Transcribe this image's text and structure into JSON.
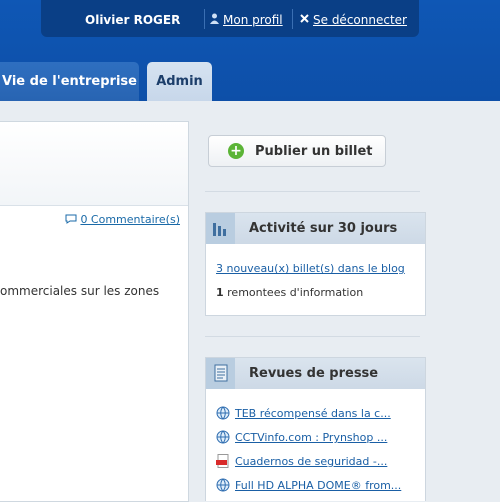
{
  "header": {
    "username": "Olivier ROGER",
    "profile_label": "Mon profil",
    "logout_label": "Se déconnecter"
  },
  "tabs": [
    {
      "label": "Vie de l'entreprise",
      "active": false
    },
    {
      "label": "Admin",
      "active": true
    }
  ],
  "main": {
    "comment_label": "0 Commentaire(s)",
    "body_text": "ommerciales sur les zones"
  },
  "sidebar": {
    "publish_label": "Publier un billet",
    "activity": {
      "title": "Activité sur 30 jours",
      "new_posts_label": "3 nouveau(x) billet(s) dans le blog",
      "feedback_count": "1",
      "feedback_label": "remontees d'information"
    },
    "press": {
      "title": "Revues de presse",
      "items": [
        {
          "label": "TEB récompensé dans la c...",
          "icon": "web-link-icon"
        },
        {
          "label": "CCTVinfo.com : Prynshop ...",
          "icon": "web-link-icon"
        },
        {
          "label": "Cuadernos de seguridad -...",
          "icon": "pdf-icon"
        },
        {
          "label": "Full HD ALPHA DOME® from...",
          "icon": "web-link-icon"
        }
      ]
    }
  },
  "colors": {
    "header_blue": "#0f57b5",
    "link_blue": "#1a5fa5",
    "add_green": "#5bb436"
  }
}
